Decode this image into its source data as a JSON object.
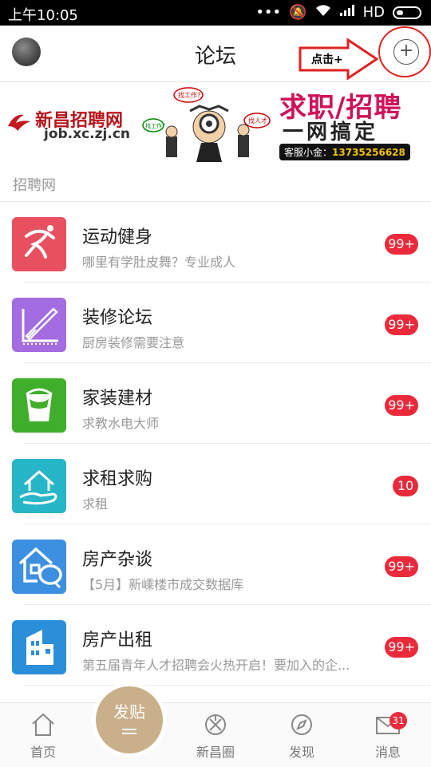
{
  "status_bar": {
    "time": "上午10:05",
    "signal_text": "HD"
  },
  "header": {
    "title": "论坛",
    "annotation": "点击+",
    "plus": "+"
  },
  "banner": {
    "brand": "新昌招聘网",
    "url": "job.xc.zj.cn",
    "bubble_left": "找工作？",
    "bubble_top": "找工作?",
    "bubble_right": "找人才",
    "headline": "求职/招聘",
    "slogan": "一网搞定",
    "hotline_label": "客服小金：",
    "hotline_number": "13735256628"
  },
  "section": {
    "title": "招聘网"
  },
  "forums": [
    {
      "name": "运动健身",
      "desc": "哪里有学肚皮舞？专业成人",
      "badge": "99+",
      "color": "#e9505f",
      "icon": "running-icon"
    },
    {
      "name": "装修论坛",
      "desc": "厨房装修需要注意",
      "badge": "99+",
      "color": "#a36ce0",
      "icon": "ruler-pen-icon"
    },
    {
      "name": "家装建材",
      "desc": "求教水电大师",
      "badge": "99+",
      "color": "#3fae2a",
      "icon": "paint-bucket-icon"
    },
    {
      "name": "求租求购",
      "desc": "求租",
      "badge": "10",
      "color": "#27b6c8",
      "icon": "house-hand-icon"
    },
    {
      "name": "房产杂谈",
      "desc": "【5月】新嵊楼市成交数据库",
      "badge": "99+",
      "color": "#3d8fe0",
      "icon": "house-chat-icon"
    },
    {
      "name": "房产出租",
      "desc": "第五届青年人才招聘会火热开启！要加入的企...",
      "badge": "99+",
      "color": "#2b8ed8",
      "icon": "building-icon"
    }
  ],
  "bottom_nav": {
    "home": "首页",
    "post": "发贴",
    "circle": "新昌圈",
    "discover": "发现",
    "messages": "消息",
    "message_count": "31"
  }
}
